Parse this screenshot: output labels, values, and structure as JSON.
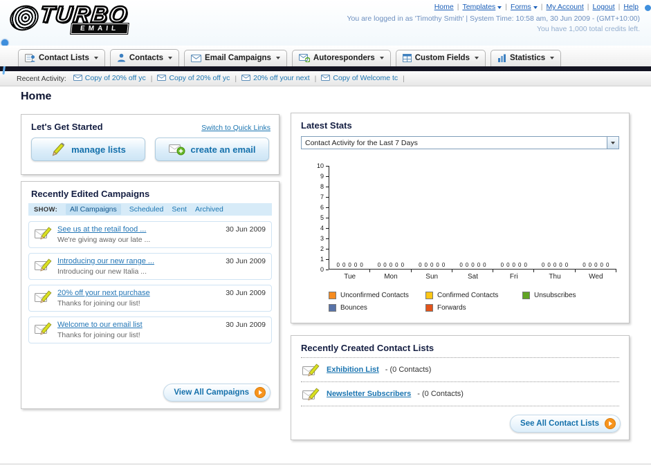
{
  "colors": {
    "accent_blue": "#1b75b1",
    "dark_navy": "#141e42",
    "nav_bar_dark": "#131321",
    "button_text": "#1470ab",
    "orange": "#f7941d"
  },
  "header": {
    "logo_title": "TURBO",
    "logo_subtitle": "EMAIL",
    "links": [
      {
        "label": "Home",
        "dropdown": false
      },
      {
        "label": "Templates",
        "dropdown": true
      },
      {
        "label": "Forms",
        "dropdown": true
      },
      {
        "label": "My Account",
        "dropdown": false
      },
      {
        "label": "Logout",
        "dropdown": false
      },
      {
        "label": "Help",
        "dropdown": false
      }
    ],
    "status_line": "You are logged in as 'Timothy Smith' | System Time: 10:58 am, 30 Jun 2009 - (GMT+10:00)",
    "credits_line": "You have 1,000 total credits left."
  },
  "nav": {
    "tabs": [
      {
        "label": "Contact Lists",
        "icon": "contact-lists-icon"
      },
      {
        "label": "Contacts",
        "icon": "contacts-icon"
      },
      {
        "label": "Email Campaigns",
        "icon": "email-campaigns-icon"
      },
      {
        "label": "Autoresponders",
        "icon": "autoresponders-icon"
      },
      {
        "label": "Custom Fields",
        "icon": "custom-fields-icon"
      },
      {
        "label": "Statistics",
        "icon": "statistics-icon"
      }
    ]
  },
  "recent_activity": {
    "label": "Recent Activity:",
    "items": [
      {
        "label": "Copy of 20% off yc"
      },
      {
        "label": "Copy of 20% off yc"
      },
      {
        "label": "20% off your next"
      },
      {
        "label": "Copy of Welcome tc"
      }
    ]
  },
  "page": {
    "title": "Home"
  },
  "get_started": {
    "title": "Let's Get Started",
    "switch_link": "Switch to Quick Links",
    "buttons": [
      {
        "label": "manage lists",
        "icon": "pencil-icon"
      },
      {
        "label": "create an email",
        "icon": "envelope-plus-icon"
      }
    ]
  },
  "campaigns": {
    "title": "Recently Edited Campaigns",
    "show_label": "SHOW:",
    "filters": [
      {
        "label": "All Campaigns",
        "active": true
      },
      {
        "label": "Scheduled",
        "active": false
      },
      {
        "label": "Sent",
        "active": false
      },
      {
        "label": "Archived",
        "active": false
      }
    ],
    "items": [
      {
        "title": "See us at the retail food ...",
        "subtitle": "We're giving away our late ...",
        "date": "30 Jun 2009"
      },
      {
        "title": "Introducing our new range ...",
        "subtitle": "Introducing our new Italia ...",
        "date": "30 Jun 2009"
      },
      {
        "title": "20% off your next purchase",
        "subtitle": "Thanks for joining our list!",
        "date": "30 Jun 2009"
      },
      {
        "title": "Welcome to our email list",
        "subtitle": "Thanks for joining our list!",
        "date": "30 Jun 2009"
      }
    ],
    "view_all_label": "View All Campaigns"
  },
  "stats": {
    "title": "Latest Stats",
    "dropdown_value": "Contact Activity for the Last 7 Days"
  },
  "chart_data": {
    "type": "bar",
    "title": "Contact Activity for the Last 7 Days",
    "categories": [
      "Tue",
      "Mon",
      "Sun",
      "Sat",
      "Fri",
      "Thu",
      "Wed"
    ],
    "series": [
      {
        "name": "Unconfirmed Contacts",
        "color": "#f68b1f",
        "values": [
          0,
          0,
          0,
          0,
          0,
          0,
          0
        ]
      },
      {
        "name": "Confirmed Contacts",
        "color": "#fdc616",
        "values": [
          0,
          0,
          0,
          0,
          0,
          0,
          0
        ]
      },
      {
        "name": "Unsubscribes",
        "color": "#61a423",
        "values": [
          0,
          0,
          0,
          0,
          0,
          0,
          0
        ]
      },
      {
        "name": "Bounces",
        "color": "#5873a8",
        "values": [
          0,
          0,
          0,
          0,
          0,
          0,
          0
        ]
      },
      {
        "name": "Forwards",
        "color": "#e2541b",
        "values": [
          0,
          0,
          0,
          0,
          0,
          0,
          0
        ]
      }
    ],
    "ylim": [
      0,
      10
    ],
    "ytick_step": 1,
    "show_value_labels": true,
    "legend_position": "bottom",
    "grid": false
  },
  "contact_lists": {
    "title": "Recently Created Contact Lists",
    "items": [
      {
        "name": "Exhibition List",
        "detail": "- (0 Contacts)"
      },
      {
        "name": "Newsletter Subscribers",
        "detail": "- (0 Contacts)"
      }
    ],
    "see_all_label": "See All Contact Lists"
  }
}
